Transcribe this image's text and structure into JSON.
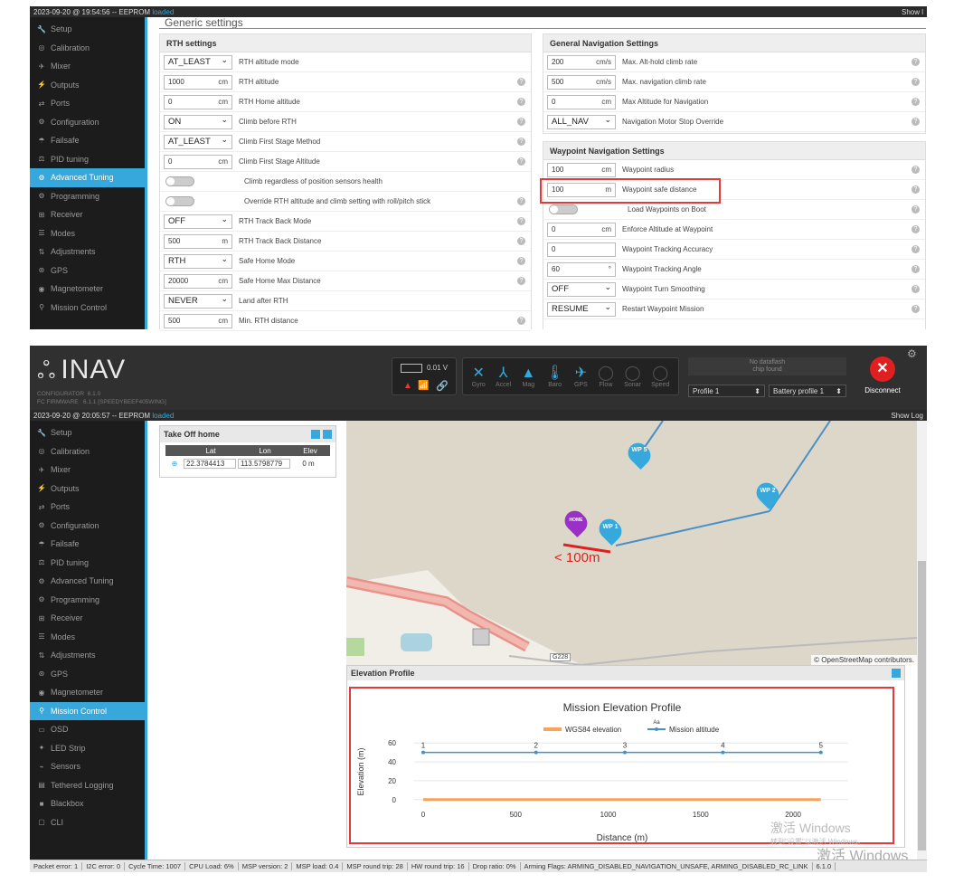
{
  "top": {
    "status_time": "2023-09-20 @ 19:54:56 -- EEPROM",
    "status_ok": "loaded",
    "show_log": "Show l",
    "section_title": "Generic settings",
    "rth_title": "RTH settings",
    "gen_nav_title": "General Navigation Settings",
    "wp_title": "Waypoint Navigation Settings",
    "rth_rows": [
      {
        "kind": "select",
        "value": "AT_LEAST",
        "label": "RTH altitude mode",
        "help": false
      },
      {
        "kind": "input",
        "value": "1000",
        "unit": "cm",
        "label": "RTH altitude",
        "help": true
      },
      {
        "kind": "input",
        "value": "0",
        "unit": "cm",
        "label": "RTH Home altitude",
        "help": true
      },
      {
        "kind": "select",
        "value": "ON",
        "label": "Climb before RTH",
        "help": true
      },
      {
        "kind": "select",
        "value": "AT_LEAST",
        "label": "Climb First Stage Method",
        "help": true
      },
      {
        "kind": "input",
        "value": "0",
        "unit": "cm",
        "label": "Climb First Stage Altitude",
        "help": true
      },
      {
        "kind": "toggle",
        "label": "Climb regardless of position sensors health",
        "help": false
      },
      {
        "kind": "toggle",
        "label": "Override RTH altitude and climb setting with roll/pitch stick",
        "help": true
      },
      {
        "kind": "select",
        "value": "OFF",
        "label": "RTH Track Back Mode",
        "help": true
      },
      {
        "kind": "input",
        "value": "500",
        "unit": "m",
        "label": "RTH Track Back Distance",
        "help": true
      },
      {
        "kind": "select",
        "value": "RTH",
        "label": "Safe Home Mode",
        "help": true
      },
      {
        "kind": "input",
        "value": "20000",
        "unit": "cm",
        "label": "Safe Home Max Distance",
        "help": true
      },
      {
        "kind": "select",
        "value": "NEVER",
        "label": "Land after RTH",
        "help": false
      },
      {
        "kind": "input",
        "value": "500",
        "unit": "cm",
        "label": "Min. RTH distance",
        "help": true
      }
    ],
    "gen_rows": [
      {
        "kind": "input",
        "value": "200",
        "unit": "cm/s",
        "label": "Max. Alt-hold climb rate",
        "help": true
      },
      {
        "kind": "input",
        "value": "500",
        "unit": "cm/s",
        "label": "Max. navigation climb rate",
        "help": true
      },
      {
        "kind": "input",
        "value": "0",
        "unit": "cm",
        "label": "Max Altitude for Navigation",
        "help": true
      },
      {
        "kind": "select",
        "value": "ALL_NAV",
        "label": "Navigation Motor Stop Override",
        "help": true
      }
    ],
    "wp_rows": [
      {
        "kind": "input",
        "value": "100",
        "unit": "cm",
        "label": "Waypoint radius",
        "help": true
      },
      {
        "kind": "input",
        "value": "100",
        "unit": "m",
        "label": "Waypoint safe distance",
        "help": true
      },
      {
        "kind": "toggle",
        "label": "Load Waypoints on Boot",
        "help": true
      },
      {
        "kind": "input",
        "value": "0",
        "unit": "cm",
        "label": "Enforce Altitude at Waypoint",
        "help": true
      },
      {
        "kind": "input",
        "value": "0",
        "unit": "",
        "label": "Waypoint Tracking Accuracy",
        "help": true
      },
      {
        "kind": "input",
        "value": "60",
        "unit": "°",
        "label": "Waypoint Tracking Angle",
        "help": true
      },
      {
        "kind": "select",
        "value": "OFF",
        "label": "Waypoint Turn Smoothing",
        "help": true
      },
      {
        "kind": "select",
        "value": "RESUME",
        "label": "Restart Waypoint Mission",
        "help": true
      }
    ]
  },
  "sidebar_top": [
    "Setup",
    "Calibration",
    "Mixer",
    "Outputs",
    "Ports",
    "Configuration",
    "Failsafe",
    "PID tuning",
    "Advanced Tuning",
    "Programming",
    "Receiver",
    "Modes",
    "Adjustments",
    "GPS",
    "Magnetometer",
    "Mission Control"
  ],
  "sidebar_bottom": [
    "Setup",
    "Calibration",
    "Mixer",
    "Outputs",
    "Ports",
    "Configuration",
    "Failsafe",
    "PID tuning",
    "Advanced Tuning",
    "Programming",
    "Receiver",
    "Modes",
    "Adjustments",
    "GPS",
    "Magnetometer",
    "Mission Control",
    "OSD",
    "LED Strip",
    "Sensors",
    "Tethered Logging",
    "Blackbox",
    "CLI"
  ],
  "header": {
    "logo": "INAV",
    "configurator": "CONFIGURATOR  6.1.0",
    "firmware": "FC FIRMWARE   6.1.1 [SPEEDYBEEF405WING]",
    "voltage": "0.01 V",
    "sensors": [
      "Gyro",
      "Accel",
      "Mag",
      "Baro",
      "GPS",
      "Flow",
      "Sonar",
      "Speed"
    ],
    "dataflash": "No dataflash\nchip found",
    "profile": "Profile 1",
    "battery_profile": "Battery profile 1",
    "disconnect": "Disconnect"
  },
  "bottom_status": {
    "time": "2023-09-20 @ 20:05:57 -- EEPROM",
    "ok": "loaded",
    "show_log": "Show Log"
  },
  "takeoff": {
    "title": "Take Off home",
    "cols": [
      "Lat",
      "Lon",
      "Elev"
    ],
    "lat": "22.3784413",
    "lon": "113.5798779",
    "elev": "0 m"
  },
  "map": {
    "wps": [
      "WP 5",
      "WP 2",
      "WP 1"
    ],
    "home": "HOME",
    "annotation": "< 100m",
    "osm": "© OpenStreetMap contributors.",
    "roads": [
      "G228"
    ]
  },
  "elevation": {
    "panel_title": "Elevation Profile"
  },
  "chart_data": {
    "type": "line",
    "title": "Mission Elevation Profile",
    "xlabel": "Distance (m)",
    "ylabel": "Elevation (m)",
    "legend": [
      "WGS84 elevation",
      "Mission altitude"
    ],
    "legend_extra": "Aa",
    "xlim": [
      0,
      2200
    ],
    "ylim": [
      -5,
      65
    ],
    "xticks": [
      0,
      500,
      1000,
      1500,
      2000
    ],
    "yticks": [
      0,
      20,
      40,
      60
    ],
    "series": [
      {
        "name": "WGS84 elevation",
        "color": "#f7a35c",
        "x": [
          0,
          2150
        ],
        "y": [
          0,
          0
        ]
      },
      {
        "name": "Mission altitude",
        "color": "#4a90c8",
        "x": [
          0,
          610,
          1090,
          1620,
          2150
        ],
        "y": [
          50,
          50,
          50,
          50,
          50
        ],
        "labels": [
          "1",
          "2",
          "3",
          "4",
          "5"
        ]
      }
    ],
    "grid": true,
    "legend_position": "top"
  },
  "watermark": [
    "激活 Windows",
    "转到\"设置\"以激活 Windows。"
  ],
  "watermark2": "激活 Windows",
  "statusbar": [
    "Packet error: 1",
    "I2C error: 0",
    "Cycle Time: 1007",
    "CPU Load: 6%",
    "MSP version: 2",
    "MSP load: 0.4",
    "MSP round trip: 28",
    "HW round trip: 16",
    "Drop ratio: 0%",
    "Arming Flags: ARMING_DISABLED_NAVIGATION_UNSAFE, ARMING_DISABLED_RC_LINK",
    "6.1.0"
  ]
}
